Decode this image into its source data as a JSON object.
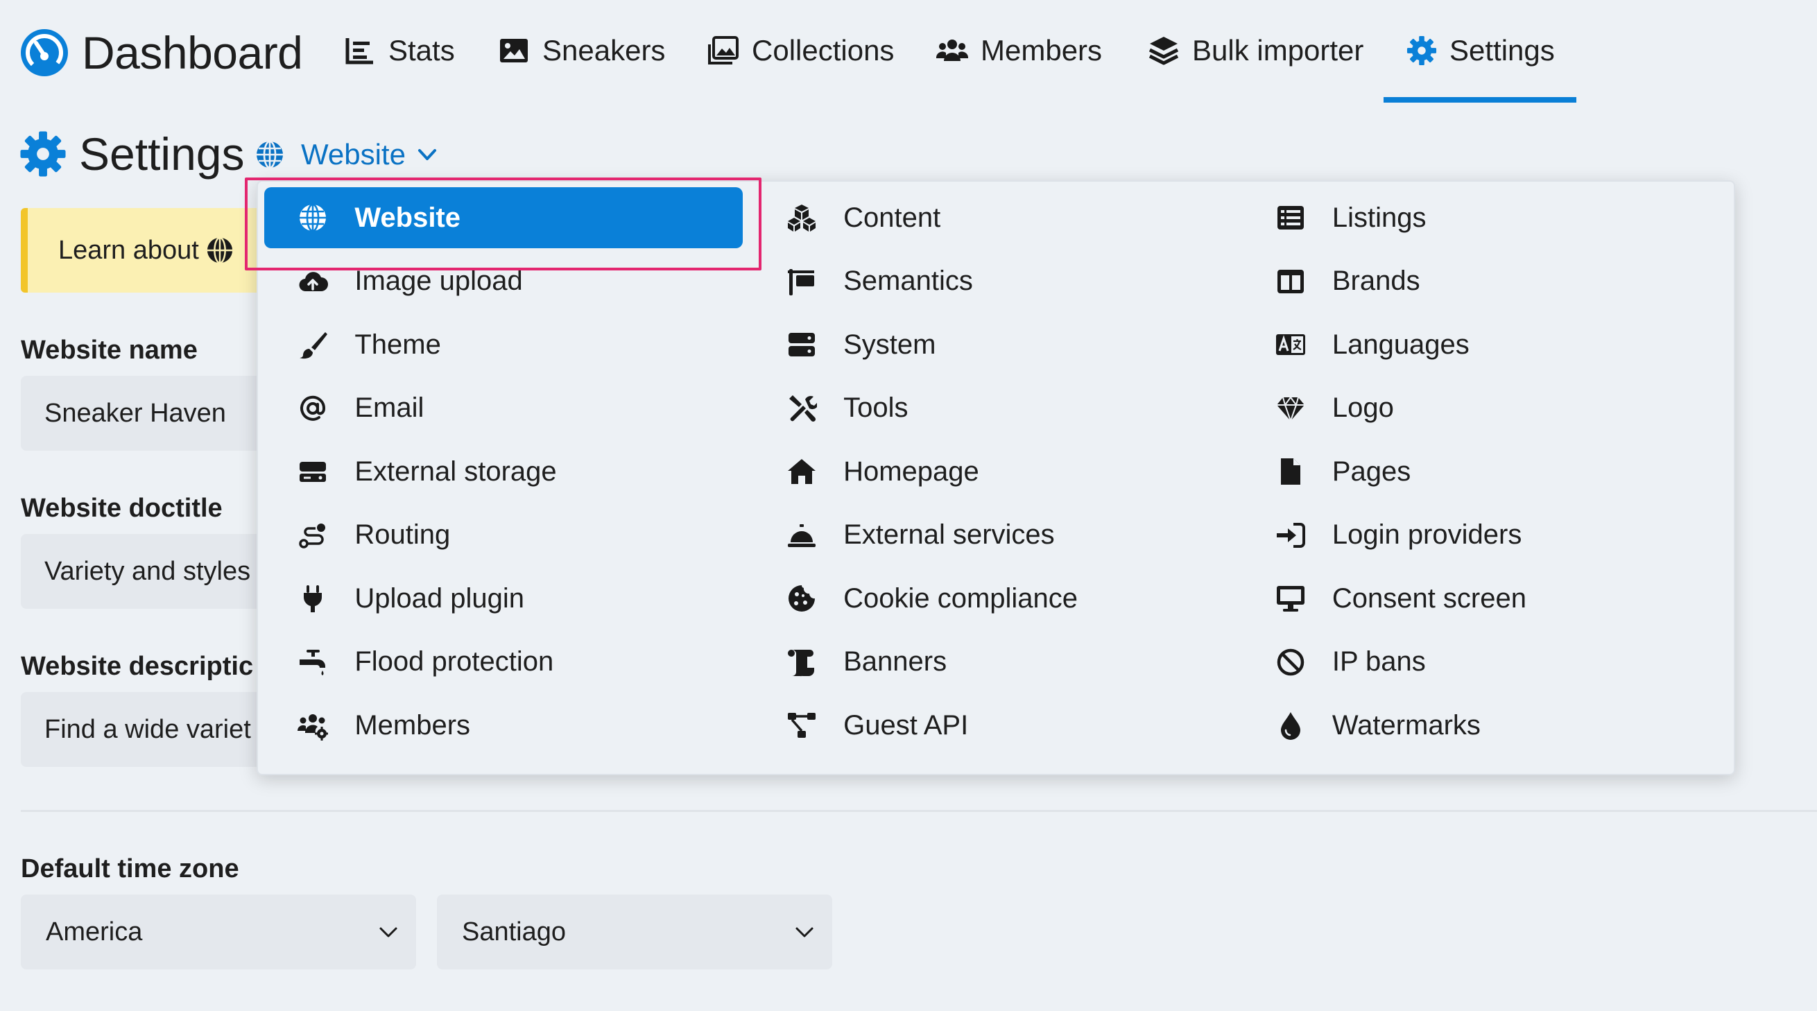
{
  "colors": {
    "accent": "#0a80d8",
    "highlight": "#e3266f",
    "notice_bg": "#fbf0b3",
    "notice_border": "#f2c52a"
  },
  "brand": {
    "title": "Dashboard",
    "icon": "gauge-icon"
  },
  "nav": [
    {
      "label": "Stats",
      "icon": "chart-icon"
    },
    {
      "label": "Sneakers",
      "icon": "image-icon"
    },
    {
      "label": "Collections",
      "icon": "images-icon"
    },
    {
      "label": "Members",
      "icon": "users-icon"
    },
    {
      "label": "Bulk importer",
      "icon": "layers-icon"
    },
    {
      "label": "Settings",
      "icon": "gear-icon",
      "active": true
    }
  ],
  "settings": {
    "title": "Settings",
    "site_selector": "Website"
  },
  "notice": {
    "text": "Learn about"
  },
  "form": {
    "name_label": "Website name",
    "name_value": "Sneaker Haven",
    "doctitle_label": "Website doctitle",
    "doctitle_value": "Variety and styles",
    "description_label": "Website descriptic",
    "description_value": "Find a wide variet",
    "timezone_label": "Default time zone",
    "timezone_region": "America",
    "timezone_city": "Santiago"
  },
  "menu": {
    "columns": [
      [
        {
          "label": "Website",
          "icon": "globe-icon",
          "active": true
        },
        {
          "label": "Image upload",
          "icon": "cloud-upload-icon"
        },
        {
          "label": "Theme",
          "icon": "brush-icon"
        },
        {
          "label": "Email",
          "icon": "at-icon"
        },
        {
          "label": "External storage",
          "icon": "hdd-icon"
        },
        {
          "label": "Routing",
          "icon": "route-icon"
        },
        {
          "label": "Upload plugin",
          "icon": "plug-icon"
        },
        {
          "label": "Flood protection",
          "icon": "faucet-icon"
        },
        {
          "label": "Members",
          "icon": "users-gear-icon"
        }
      ],
      [
        {
          "label": "Content",
          "icon": "cubes-icon"
        },
        {
          "label": "Semantics",
          "icon": "sign-icon"
        },
        {
          "label": "System",
          "icon": "server-icon"
        },
        {
          "label": "Tools",
          "icon": "tools-icon"
        },
        {
          "label": "Homepage",
          "icon": "home-icon"
        },
        {
          "label": "External services",
          "icon": "bell-concierge-icon"
        },
        {
          "label": "Cookie compliance",
          "icon": "cookie-icon"
        },
        {
          "label": "Banners",
          "icon": "scroll-icon"
        },
        {
          "label": "Guest API",
          "icon": "network-icon"
        }
      ],
      [
        {
          "label": "Listings",
          "icon": "list-icon"
        },
        {
          "label": "Brands",
          "icon": "columns-icon"
        },
        {
          "label": "Languages",
          "icon": "language-icon"
        },
        {
          "label": "Logo",
          "icon": "gem-icon"
        },
        {
          "label": "Pages",
          "icon": "file-icon"
        },
        {
          "label": "Login providers",
          "icon": "sign-in-icon"
        },
        {
          "label": "Consent screen",
          "icon": "desktop-icon"
        },
        {
          "label": "IP bans",
          "icon": "ban-icon"
        },
        {
          "label": "Watermarks",
          "icon": "droplet-icon"
        }
      ]
    ]
  }
}
